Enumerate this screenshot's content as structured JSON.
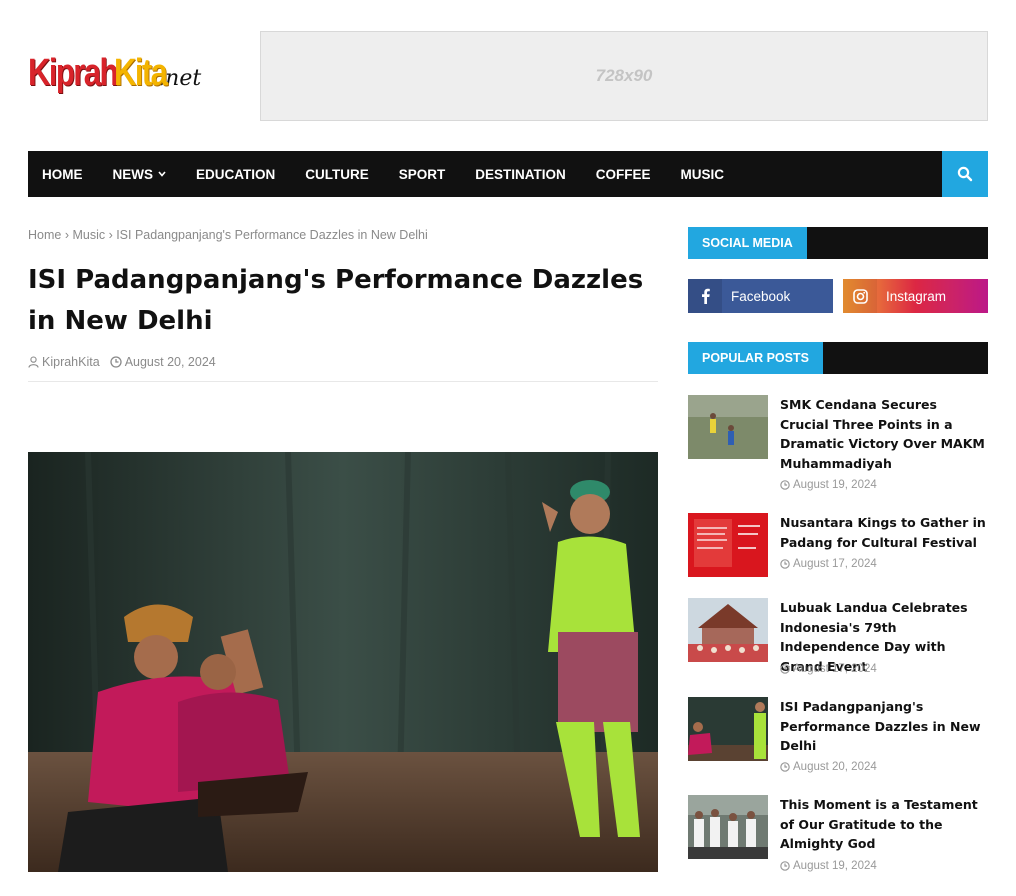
{
  "header": {
    "logo_part1": "Kiprah",
    "logo_part2": "Kita",
    "logo_part3": ".net",
    "ad_label": "728x90"
  },
  "nav": {
    "items": [
      {
        "label": "HOME"
      },
      {
        "label": "NEWS",
        "has_dropdown": true
      },
      {
        "label": "EDUCATION"
      },
      {
        "label": "CULTURE"
      },
      {
        "label": "SPORT"
      },
      {
        "label": "DESTINATION"
      },
      {
        "label": "COFFEE"
      },
      {
        "label": "MUSIC"
      }
    ],
    "search_icon": "search-icon"
  },
  "article": {
    "breadcrumb": "Home › Music › ISI Padangpanjang's Performance Dazzles in New Delhi",
    "title": "ISI Padangpanjang's Performance Dazzles in New Delhi",
    "author": "KiprahKita",
    "date": "August 20, 2024"
  },
  "sidebar": {
    "social_heading": "SOCIAL MEDIA",
    "facebook_label": "Facebook",
    "instagram_label": "Instagram",
    "popular_heading": "POPULAR POSTS",
    "posts": [
      {
        "title": "SMK Cendana Secures Crucial Three Points in a Dramatic Victory Over MAKM Muhammadiyah",
        "date": "August 19, 2024"
      },
      {
        "title": "Nusantara Kings to Gather in Padang for Cultural Festival",
        "date": "August 17, 2024"
      },
      {
        "title": "Lubuak Landua Celebrates Indonesia's 79th Independence Day with Grand Event",
        "date": "August 17, 2024"
      },
      {
        "title": "ISI Padangpanjang's Performance Dazzles in New Delhi",
        "date": "August 20, 2024"
      },
      {
        "title": "This Moment is a Testament of Our Gratitude to the Almighty God",
        "date": "August 19, 2024"
      }
    ]
  },
  "colors": {
    "accent": "#22a7e0",
    "nav_bg": "#111111",
    "logo_red": "#d8232a",
    "logo_yellow": "#f4b400",
    "facebook": "#3b5998"
  }
}
